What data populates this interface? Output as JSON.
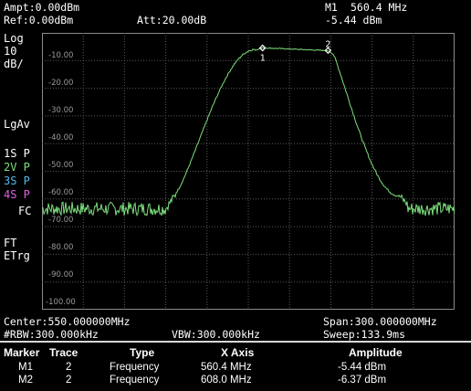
{
  "header": {
    "ampt": "Ampt:0.00dBm",
    "ref": "Ref:0.00dBm",
    "att": "Att:20.00dB",
    "marker_name": "M1",
    "marker_freq": "560.4 MHz",
    "marker_amp": "-5.44 dBm"
  },
  "side": {
    "scale_type": "Log",
    "scale_div": "10",
    "scale_unit": "dB/",
    "avg": "LgAv",
    "traces": [
      {
        "num": "1",
        "mode": "S P",
        "color": "#ffffff"
      },
      {
        "num": "2",
        "mode": "V P",
        "color": "#7de07d"
      },
      {
        "num": "3",
        "mode": "S P",
        "color": "#58b7e8"
      },
      {
        "num": "4",
        "mode": "S P",
        "color": "#e060e0"
      }
    ],
    "fc": "FC",
    "ft": "FT",
    "etrg": "ETrg"
  },
  "y_labels": [
    "-10.00",
    "-20.00",
    "-30.00",
    "-40.00",
    "-50.00",
    "-60.00",
    "-70.00",
    "-80.00",
    "-90.00",
    "-100.00"
  ],
  "footer": {
    "center": "Center:550.000000MHz",
    "span": "Span:300.000000MHz",
    "rbw": "#RBW:300.000kHz",
    "vbw": "VBW:300.000kHz",
    "sweep": "Sweep:133.9ms"
  },
  "marker_table": {
    "headers": {
      "marker": "Marker",
      "trace": "Trace",
      "type": "Type",
      "x_axis": "X Axis",
      "amplitude": "Amplitude"
    },
    "rows": [
      {
        "marker": "M1",
        "trace": "2",
        "type": "Frequency",
        "x": "560.4 MHz",
        "amp": "-5.44 dBm"
      },
      {
        "marker": "M2",
        "trace": "2",
        "type": "Frequency",
        "x": "608.0 MHz",
        "amp": "-6.37 dBm"
      }
    ]
  },
  "markers_on_plot": [
    {
      "label": "1",
      "freq_mhz": 560.4,
      "amp_dbm": -5.44
    },
    {
      "label": "2",
      "freq_mhz": 608.0,
      "amp_dbm": -6.37
    }
  ],
  "trace_line_color": "#7de07d",
  "grid_color": "#5a5a5a"
}
